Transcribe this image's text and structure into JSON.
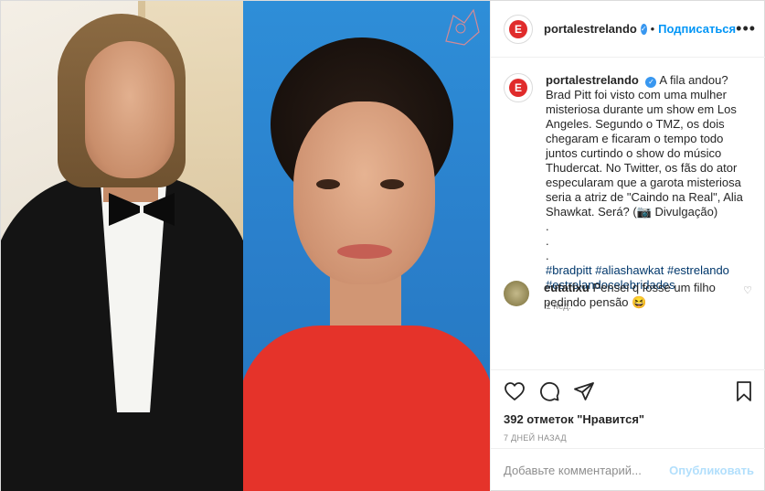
{
  "header": {
    "username": "portalestrelando",
    "separator": "•",
    "follow_label": "Подписаться",
    "more_label": "•••",
    "verified_symbol": "✓",
    "avatar_letter": "E"
  },
  "caption": {
    "username": "portalestrelando",
    "text": "A fila andou? Brad Pitt foi visto com uma mulher misteriosa durante um show em Los Angeles. Segundo o TMZ, os dois chegaram e ficaram o tempo todo juntos curtindo o show do músico Thudercat. No Twitter, os fãs do ator especularam que a garota misteriosa seria a atriz de \"Caindo na Real\", Alia Shawkat. Será? (📷 Divulgação)",
    "dots": [
      ".",
      ".",
      "."
    ],
    "tags_line1": "#bradpitt #aliashawkat #estrelando",
    "tags_line2": "#estrelandocelebridades",
    "time": "1 нед."
  },
  "comment": {
    "username": "eutatixu",
    "text": "Pensei q fosse um filho pedindo pensão 😆"
  },
  "actions": {
    "likes": "392 отметок \"Нравится\"",
    "posted_ago": "7 ДНЕЙ НАЗАД"
  },
  "add_comment": {
    "placeholder": "Добавьте комментарий...",
    "publish_label": "Опубликовать"
  },
  "colors": {
    "link_blue": "#0095f6",
    "tag_blue": "#00376b",
    "publish_disabled": "#b2dffc",
    "verified_blue": "#3897f0",
    "brand_red": "#e02b2b"
  },
  "icons": [
    "heart-icon",
    "comment-icon",
    "share-icon",
    "bookmark-icon",
    "more-icon",
    "verified-icon"
  ]
}
